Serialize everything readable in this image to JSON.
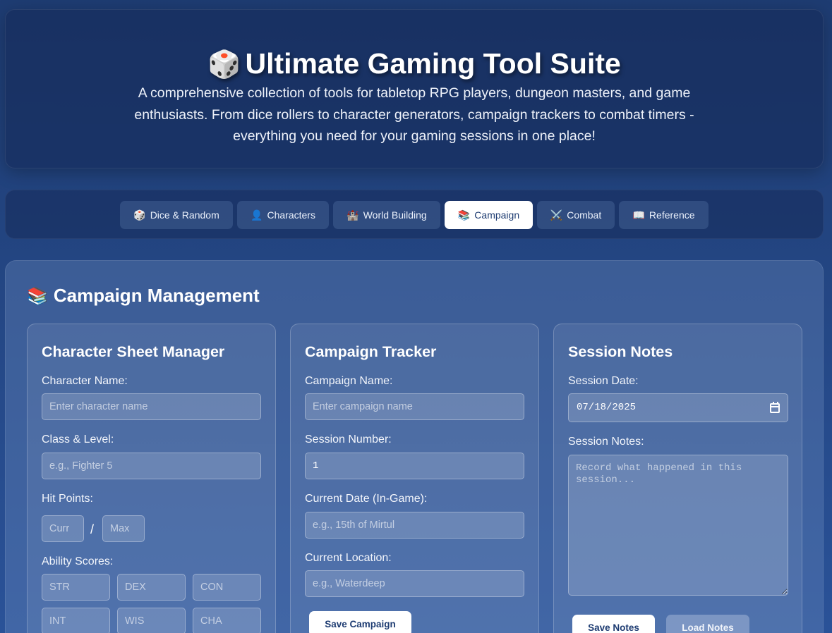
{
  "header": {
    "icon": "🎲",
    "title": "Ultimate Gaming Tool Suite",
    "description": "A comprehensive collection of tools for tabletop RPG players, dungeon masters, and game enthusiasts. From dice rollers to character generators, campaign trackers to combat timers - everything you need for your gaming sessions in one place!"
  },
  "nav": {
    "tabs": [
      {
        "icon": "🎲",
        "label": "Dice & Random"
      },
      {
        "icon": "👤",
        "label": "Characters"
      },
      {
        "icon": "🏰",
        "label": "World Building"
      },
      {
        "icon": "📚",
        "label": "Campaign",
        "active": true
      },
      {
        "icon": "⚔️",
        "label": "Combat"
      },
      {
        "icon": "📖",
        "label": "Reference"
      }
    ]
  },
  "panel": {
    "icon": "📚",
    "title": "Campaign Management"
  },
  "character_sheet": {
    "title": "Character Sheet Manager",
    "name_label": "Character Name:",
    "name_placeholder": "Enter character name",
    "class_label": "Class & Level:",
    "class_placeholder": "e.g., Fighter 5",
    "hp_label": "Hit Points:",
    "hp_current_placeholder": "Curr",
    "hp_separator": "/",
    "hp_max_placeholder": "Max",
    "ability_label": "Ability Scores:",
    "abilities": [
      "STR",
      "DEX",
      "CON",
      "INT",
      "WIS",
      "CHA"
    ]
  },
  "campaign_tracker": {
    "title": "Campaign Tracker",
    "name_label": "Campaign Name:",
    "name_placeholder": "Enter campaign name",
    "session_label": "Session Number:",
    "session_value": "1",
    "date_label": "Current Date (In-Game):",
    "date_placeholder": "e.g., 15th of Mirtul",
    "location_label": "Current Location:",
    "location_placeholder": "e.g., Waterdeep",
    "save_label": "Save Campaign"
  },
  "session_notes": {
    "title": "Session Notes",
    "date_label": "Session Date:",
    "date_value": "07/18/2025",
    "notes_label": "Session Notes:",
    "notes_placeholder": "Record what happened in this session...",
    "save_label": "Save Notes",
    "load_label": "Load Notes"
  }
}
